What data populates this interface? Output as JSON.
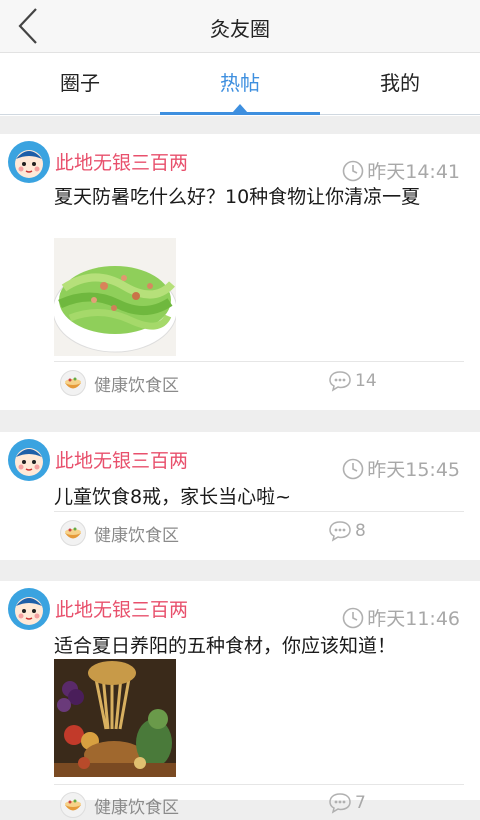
{
  "header": {
    "title": "灸友圈"
  },
  "tabs": [
    {
      "label": "圈子",
      "active": false
    },
    {
      "label": "热帖",
      "active": true
    },
    {
      "label": "我的",
      "active": false
    }
  ],
  "colors": {
    "accent": "#3e8fdf",
    "username": "#e8506c",
    "meta": "#a8a8a8"
  },
  "posts": [
    {
      "author": "此地无银三百两",
      "time": "昨天14:41",
      "title": "夏天防暑吃什么好？10种食物让你清凉一夏",
      "has_image": true,
      "image_desc": "salad-dish",
      "category": "健康饮食区",
      "comments": "14"
    },
    {
      "author": "此地无银三百两",
      "time": "昨天15:45",
      "title": "儿童饮食8戒，家长当心啦~",
      "has_image": false,
      "category": "健康饮食区",
      "comments": "8"
    },
    {
      "author": "此地无银三百两",
      "time": "昨天11:46",
      "title": "适合夏日养阳的五种食材，你应该知道！",
      "has_image": true,
      "image_desc": "harvest-still-life",
      "category": "健康饮食区",
      "comments": "7"
    }
  ]
}
